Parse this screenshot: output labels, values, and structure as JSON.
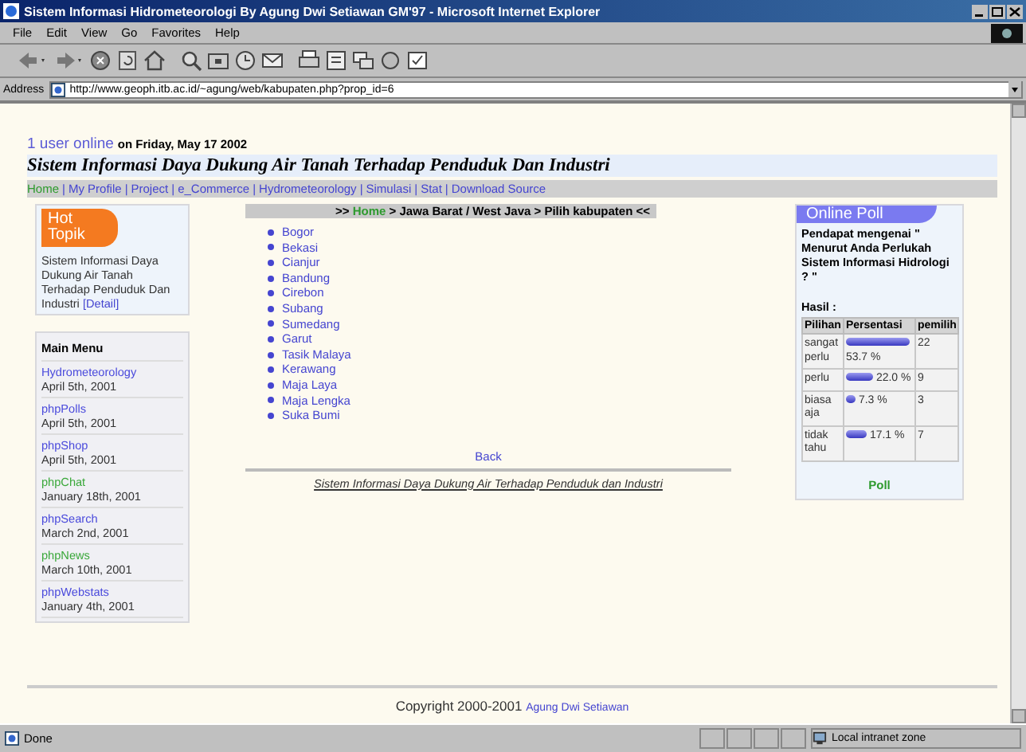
{
  "window": {
    "title": "Sistem Informasi Hidrometeorologi By Agung Dwi Setiawan GM'97 - Microsoft Internet Explorer"
  },
  "menu": [
    "File",
    "Edit",
    "View",
    "Go",
    "Favorites",
    "Help"
  ],
  "address": {
    "label": "Address",
    "value": "http://www.geoph.itb.ac.id/~agung/web/kabupaten.php?prop_id=6"
  },
  "online": {
    "count": "1 user online",
    "date": "on Friday, May 17 2002"
  },
  "site_title": "Sistem Informasi Daya Dukung Air Tanah Terhadap Penduduk Dan Industri",
  "nav": {
    "separator": "|",
    "items": [
      "Home",
      "My Profile",
      "Project",
      "e_Commerce",
      "Hydrometeorology",
      "Simulasi",
      "Stat",
      "Download Source"
    ]
  },
  "hot_topic": {
    "heading": "Hot Topik",
    "text": "Sistem Informasi Daya Dukung Air Tanah Terhadap Penduduk Dan Industri",
    "link": "[Detail]"
  },
  "main_menu": {
    "heading": "Main Menu",
    "items": [
      {
        "name": "Hydrometeorology",
        "date": "April 5th, 2001",
        "color": "#4a4adc"
      },
      {
        "name": "phpPolls",
        "date": "April 5th, 2001",
        "color": "#4a4adc"
      },
      {
        "name": "phpShop",
        "date": "April 5th, 2001",
        "color": "#4a4adc"
      },
      {
        "name": "phpChat",
        "date": "January 18th, 2001",
        "color": "#3aa83a"
      },
      {
        "name": "phpSearch",
        "date": "March 2nd, 2001",
        "color": "#4a4adc"
      },
      {
        "name": "phpNews",
        "date": "March 10th, 2001",
        "color": "#3aa83a"
      },
      {
        "name": "phpWebstats",
        "date": "January 4th, 2001",
        "color": "#4a4adc"
      }
    ]
  },
  "breadcrumb": {
    "prefix": ">>",
    "link": "Home",
    "suffix": "> Jawa Barat / West Java > Pilih kabupaten <<"
  },
  "districts": [
    "Bogor",
    "Bekasi",
    "Cianjur",
    "Bandung",
    "Cirebon",
    "Subang",
    "Sumedang",
    "Garut",
    "Tasik Malaya",
    "Kerawang",
    "Maja Laya",
    "Maja Lengka",
    "Suka Bumi"
  ],
  "back": "Back",
  "footer_link": "Sistem Informasi Daya Dukung Air Terhadap Penduduk dan Industri",
  "poll": {
    "title": "Online Poll",
    "question": "Pendapat mengenai \" Menurut Anda Perlukah Sistem Informasi Hidrologi ? \"",
    "results_label": "Hasil :",
    "columns": [
      "Pilihan",
      "Persentasi",
      "pemilih"
    ],
    "rows": [
      {
        "option": "sangat perlu",
        "percent": "53.7 %",
        "votes": "22"
      },
      {
        "option": "perlu",
        "percent": "22.0 %",
        "votes": "9"
      },
      {
        "option": "biasa aja",
        "percent": "7.3 %",
        "votes": "3"
      },
      {
        "option": "tidak tahu",
        "percent": "17.1 %",
        "votes": "7"
      }
    ],
    "link": "Poll"
  },
  "copyright": {
    "text": "Copyright 2000-2001",
    "author": "Agung Dwi Setiawan"
  },
  "status": {
    "text": "Done",
    "zone": "Local intranet zone"
  }
}
